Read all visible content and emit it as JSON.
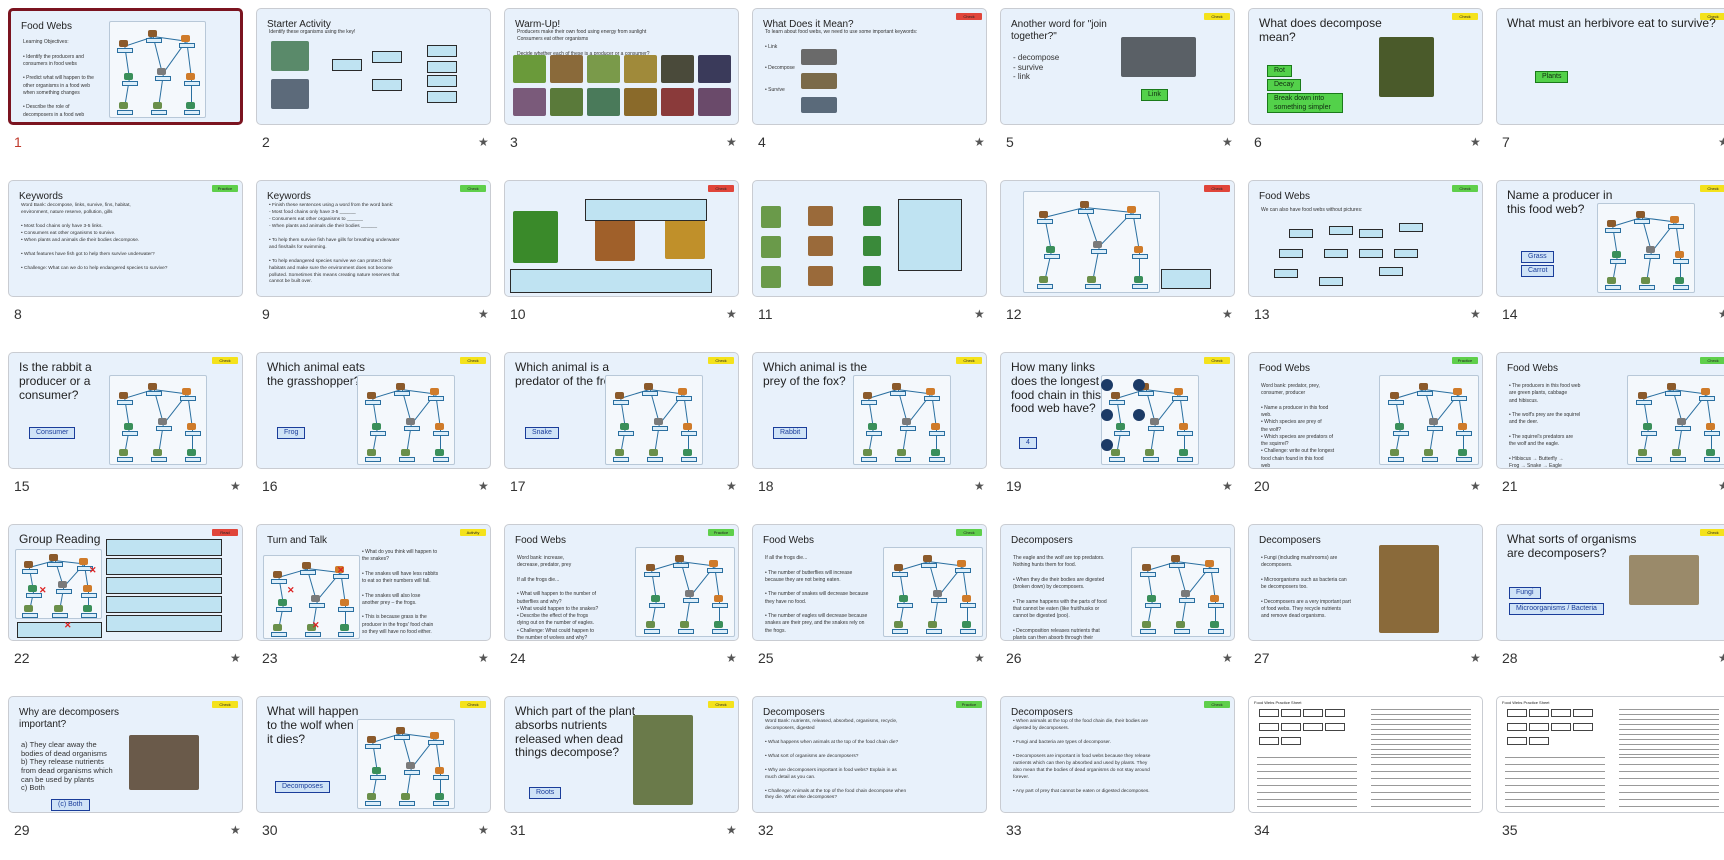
{
  "slides": [
    {
      "n": "1",
      "title": "Food Webs",
      "body": "Learning Objectives:\n\n• Identify the producers and\n  consumers in food webs\n\n• Predict what will happen to the\n  other organisms in a food web\n  when something changes\n\n• Describe the role of\n  decomposers in a food web",
      "tag": "",
      "star": "",
      "selected": true,
      "web": true
    },
    {
      "n": "2",
      "title": "Starter Activity",
      "body": "Identify these organisms using the key!",
      "tag": "",
      "star": "★"
    },
    {
      "n": "3",
      "title": "Warm-Up!",
      "body": "Producers make their own food using energy from sunlight\nConsumers eat other organisms\n\nDecide whether each of these is a producer or a consumer?",
      "tag": "",
      "star": "★"
    },
    {
      "n": "4",
      "title": "What Does it Mean?",
      "body": "To learn about food webs, we need to use some important keywords:\n\n• Link\n\n\n• Decompose\n\n\n• Survive",
      "tag": "Check",
      "tagColor": "red",
      "star": "★"
    },
    {
      "n": "5",
      "title": "Another word for \"join\ntogether?\"",
      "body": "- decompose\n- survive\n- link",
      "tag": "Check",
      "tagColor": "yellow",
      "star": "★",
      "answers": [
        {
          "text": "Link",
          "green": true
        }
      ]
    },
    {
      "n": "6",
      "title": "What does decompose\nmean?",
      "body": "",
      "tag": "Check",
      "tagColor": "yellow",
      "star": "★",
      "answers": [
        {
          "text": "Rot",
          "green": true
        },
        {
          "text": "Decay",
          "green": true
        },
        {
          "text": "Break down into something simpler",
          "green": true
        }
      ]
    },
    {
      "n": "7",
      "title": "What must an herbivore eat to survive?",
      "body": "",
      "tag": "Check",
      "tagColor": "yellow",
      "star": "★",
      "answers": [
        {
          "text": "Plants",
          "green": true
        }
      ]
    },
    {
      "n": "8",
      "title": "Keywords",
      "body": "Word Bank: decompose, links, survive, fins, habitat,\nenvironment, nature reserve, pollution, gills\n\n• Most food chains only have 3-5 links.\n• Consumers eat other organisms to survive.\n• When plants and animals die their bodies decompose.\n\n• What features have fish got to help them survive underwater?\n\n• Challenge: What can we do to help endangered species to survive?",
      "tag": "Practice",
      "tagColor": "green",
      "star": ""
    },
    {
      "n": "9",
      "title": "Keywords",
      "body": "• Finish these sentences using a word from the word bank:\n  - Most food chains only have 3-5 ______\n  - Consumers eat other organisms to ______\n  - When plants and animals die their bodies ______\n\n• To help them survive fish have gills for breathing underwater\n  and fins/tails for swimming.\n\n• To help endangered species survive we can protect their\n  habitats and make sure the environment does not become\n  polluted. Sometimes this means creating nature reserves that\n  cannot be built over.",
      "tag": "Check",
      "tagColor": "green",
      "star": "★"
    },
    {
      "n": "10",
      "title": "",
      "body": "",
      "tag": "Check",
      "tagColor": "red",
      "star": "★"
    },
    {
      "n": "11",
      "title": "",
      "body": "",
      "tag": "",
      "star": "★"
    },
    {
      "n": "12",
      "title": "",
      "body": "",
      "tag": "Check",
      "tagColor": "red",
      "star": "★"
    },
    {
      "n": "13",
      "title": "Food Webs",
      "body": "We can also have food webs without pictures:",
      "tag": "Check",
      "tagColor": "green",
      "star": "★"
    },
    {
      "n": "14",
      "title": "Name a producer in\nthis food web?",
      "body": "",
      "tag": "Check",
      "tagColor": "yellow",
      "star": "★",
      "answers": [
        {
          "text": "Grass"
        },
        {
          "text": "Carrot"
        }
      ],
      "web": true
    },
    {
      "n": "15",
      "title": "Is the rabbit a\nproducer or a\nconsumer?",
      "body": "",
      "tag": "Check",
      "tagColor": "yellow",
      "star": "★",
      "answers": [
        {
          "text": "Consumer"
        }
      ],
      "web": true
    },
    {
      "n": "16",
      "title": "Which animal eats\nthe grasshopper?",
      "body": "",
      "tag": "Check",
      "tagColor": "yellow",
      "star": "★",
      "answers": [
        {
          "text": "Frog"
        }
      ],
      "web": true
    },
    {
      "n": "17",
      "title": "Which animal is a\npredator of the frog?",
      "body": "",
      "tag": "Check",
      "tagColor": "yellow",
      "star": "★",
      "answers": [
        {
          "text": "Snake"
        }
      ],
      "web": true
    },
    {
      "n": "18",
      "title": "Which animal is the\nprey of the fox?",
      "body": "",
      "tag": "Check",
      "tagColor": "yellow",
      "star": "★",
      "answers": [
        {
          "text": "Rabbit"
        }
      ],
      "web": true
    },
    {
      "n": "19",
      "title": "How many links\ndoes the longest\nfood chain in this\nfood web have?",
      "body": "",
      "tag": "Check",
      "tagColor": "yellow",
      "star": "★",
      "answers": [
        {
          "text": "4"
        }
      ],
      "web": true
    },
    {
      "n": "20",
      "title": "Food Webs",
      "body": "Word bank: predator, prey,\nconsumer, producer\n\n• Name a producer in this food\n  web.\n• Which species are prey of\n  the wolf?\n• Which species are predators of\n  the squirrel?\n• Challenge: write out the longest\n  food chain found in this food\n  web",
      "tag": "Practice",
      "tagColor": "green",
      "star": "★",
      "web": true
    },
    {
      "n": "21",
      "title": "Food Webs",
      "body": "• The producers in this food web\n  are green plants, cabbage\n  and hibiscus.\n\n• The wolf's prey are the squirrel\n  and the deer.\n\n• The squirrel's predators are\n  the wolf and the eagle.\n\n• Hibiscus → Butterfly →\n  Frog → Snake → Eagle",
      "tag": "Check",
      "tagColor": "green",
      "star": "★",
      "web": true
    },
    {
      "n": "22",
      "title": "Group Reading",
      "body": "",
      "tag": "Read",
      "tagColor": "red",
      "star": "★"
    },
    {
      "n": "23",
      "title": "Turn and Talk",
      "body": "• What do you think will happen to\n  the snakes?\n\n• The snakes will have less rabbits\n  to eat so their numbers will fall.\n\n• The snakes will also lose\n  another prey – the frogs.\n\n• This is because grass is the\n  producer in the frogs' food chain\n  so they will have no food either.",
      "tag": "Activity",
      "tagColor": "yellow",
      "star": "★"
    },
    {
      "n": "24",
      "title": "Food Webs",
      "body": "Word bank: increase,\ndecrease, predator, prey\n\nIf all the frogs die...\n\n• What will happen to the number of\n  butterflies and why?\n• What would happen to the snakes?\n• Describe the effect of the frogs\n  dying out on the number of eagles.\n• Challenge: What could happen to\n  the number of wolves and why?",
      "tag": "Practice",
      "tagColor": "green",
      "star": "★",
      "web": true
    },
    {
      "n": "25",
      "title": "Food Webs",
      "body": "If all the frogs die...\n\n• The number of butterflies will increase\n  because they are not being eaten.\n\n• The number of snakes will decrease because\n  they have no food.\n\n• The number of eagles will decrease because\n  snakes are their prey, and the snakes rely on\n  the frogs.\n\n• The eagles would need to eat more squirrels,\n  so the wolves would have more competition\n  for prey. This would cause their numbers to\n  fall.",
      "tag": "Check",
      "tagColor": "green",
      "star": "★",
      "web": true
    },
    {
      "n": "26",
      "title": "Decomposers",
      "body": "The eagle and the wolf are top predators.\nNothing hunts them for food.\n\n• When they die their bodies are digested\n  (broken down) by decomposers.\n\n• The same happens with the parts of food\n  that cannot be eaten (like fruit/husks or\n  cannot be digested (poo).\n\n• Decomposition releases nutrients that\n  plants can then absorb through their\n  roots.",
      "tag": "",
      "star": "★",
      "web": true
    },
    {
      "n": "27",
      "title": "Decomposers",
      "body": "• Fungi (including mushrooms) are\n  decomposers.\n\n• Microorganisms such as bacteria can\n  be decomposers too.\n\n• Decomposers are a very important part\n  of food webs. They recycle nutrients\n  and remove dead organisms.",
      "tag": "",
      "star": "★"
    },
    {
      "n": "28",
      "title": "What sorts of organisms\nare decomposers?",
      "body": "",
      "tag": "Check",
      "tagColor": "yellow",
      "star": "★",
      "answers": [
        {
          "text": "Fungi"
        },
        {
          "text": "Microorganisms / Bacteria"
        }
      ]
    },
    {
      "n": "29",
      "title": "Why are decomposers\nimportant?",
      "body": "a) They clear away the\nbodies of dead organisms\nb) They release nutrients\nfrom dead organisms which\ncan be used by plants\nc) Both",
      "tag": "Check",
      "tagColor": "yellow",
      "star": "★",
      "answers": [
        {
          "text": "(c) Both"
        }
      ]
    },
    {
      "n": "30",
      "title": "What will happen\nto the wolf when\nit dies?",
      "body": "",
      "tag": "Check",
      "tagColor": "yellow",
      "star": "★",
      "answers": [
        {
          "text": "Decomposes"
        }
      ],
      "web": true
    },
    {
      "n": "31",
      "title": "Which part of the plant\nabsorbs nutrients\nreleased when dead\nthings decompose?",
      "body": "",
      "tag": "Check",
      "tagColor": "yellow",
      "star": "★",
      "answers": [
        {
          "text": "Roots"
        }
      ]
    },
    {
      "n": "32",
      "title": "Decomposers",
      "body": "Word Bank: nutrients, released, absorbed, organisms, recycle,\ndecomposers, digested\n\n• What happens when animals at the top of the food chain die?\n\n• What sort of organisms are decomposers?\n\n• Why are decomposers important in food webs? Explain in as\n  much detail as you can.\n\n• Challenge: Animals at the top of the food chain decompose when\n  they die. What else decomposes?",
      "tag": "Practice",
      "tagColor": "green",
      "star": ""
    },
    {
      "n": "33",
      "title": "Decomposers",
      "body": "• When animals at the top of the food chain die, their bodies are\n  digested by decomposers.\n\n• Fungi and bacteria are types of decomposer.\n\n• Decomposers are important in food webs because they release\n  nutrients which can then by absorbed and used by plants. They\n  also mean that the bodies of dead organisms do not stay around\n  forever.\n\n• Any part of prey that cannot be eaten or digested decomposes.",
      "tag": "Check",
      "tagColor": "green",
      "star": ""
    },
    {
      "n": "34",
      "title": "Food Webs Practice Sheet",
      "body": "",
      "tag": "",
      "star": "",
      "sheet": true
    },
    {
      "n": "35",
      "title": "Food Webs Practice Sheet",
      "body": "",
      "tag": "",
      "star": "",
      "sheet": true
    }
  ]
}
